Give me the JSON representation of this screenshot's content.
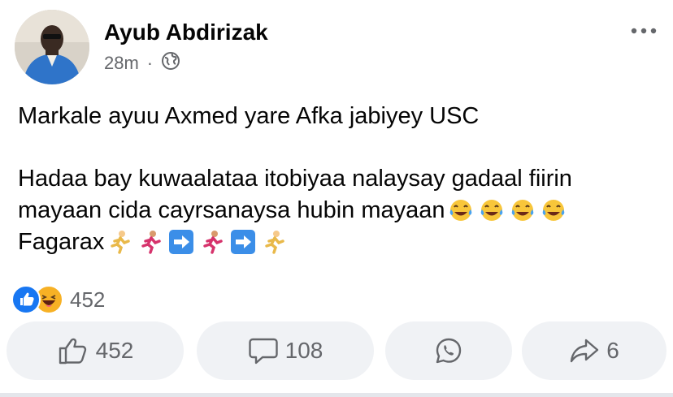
{
  "post": {
    "author": "Ayub Abdirizak",
    "time": "28m",
    "separator": "·",
    "privacy_icon": "globe-icon",
    "line1": "Markale ayuu Axmed yare Afka jabiyey USC",
    "line2": "Hadaa bay kuwaalataa itobiyaa nalaysay gadaal fiirin",
    "line3": "mayaan cida cayrsanaysa hubin mayaan",
    "line4": "Fagarax",
    "emojis_line3": [
      "tears-of-joy-emoji",
      "tears-of-joy-emoji",
      "tears-of-joy-emoji",
      "tears-of-joy-emoji"
    ],
    "emojis_line4": [
      "runner-emoji",
      "runner-emoji",
      "right-arrow-emoji",
      "runner-emoji",
      "right-arrow-emoji",
      "runner-emoji"
    ]
  },
  "reactions": {
    "icons": [
      "like-icon",
      "haha-icon"
    ],
    "count": "452"
  },
  "actions": {
    "like_count": "452",
    "comment_count": "108",
    "share_count": "6"
  },
  "colors": {
    "like_blue": "#1877f2",
    "haha_yellow": "#f7b125",
    "secondary_text": "#65676b",
    "button_bg": "#f0f2f5"
  }
}
